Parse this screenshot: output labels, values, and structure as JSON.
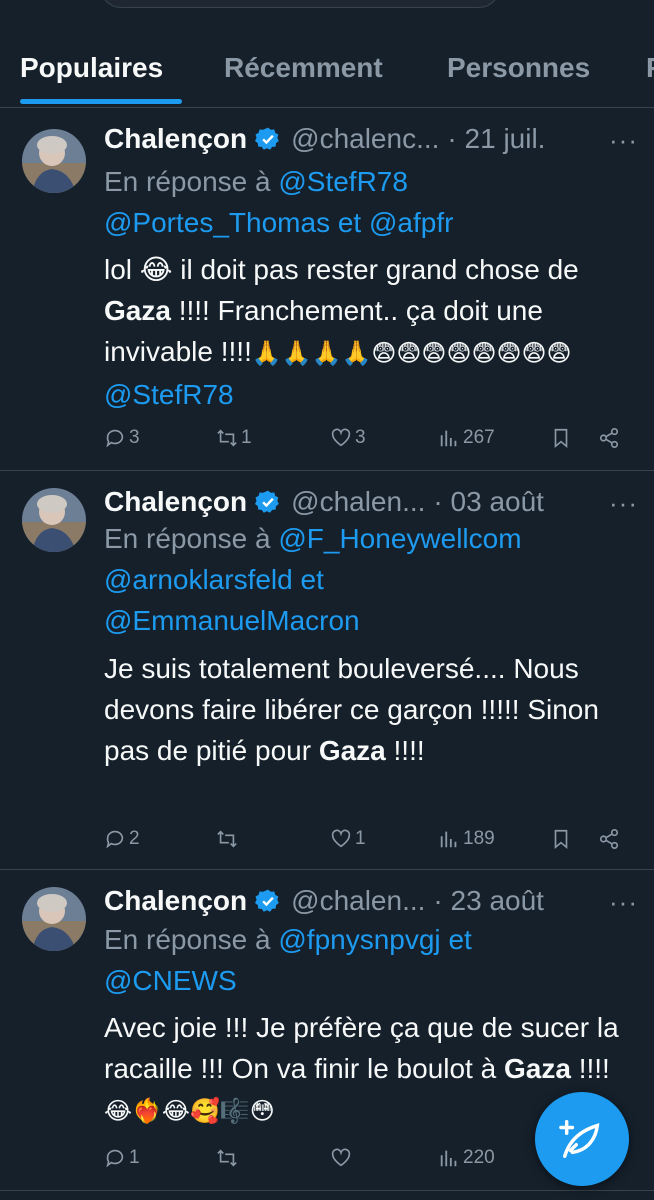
{
  "tabs": [
    {
      "label": "Populaires"
    },
    {
      "label": "Récemment"
    },
    {
      "label": "Personnes"
    },
    {
      "label": "P"
    }
  ],
  "tweets": [
    {
      "name": "Chalençon",
      "handle": "@chalenc...",
      "date": "· 21 juil.",
      "more": "···",
      "reply_prefix": "En réponse à",
      "mentions": [
        "@StefR78",
        "@Portes_Thomas",
        "@afpfr"
      ],
      "conj": "et",
      "text": {
        "t1": "lol 😂 il doit pas rester grand chose de ",
        "bold": "Gaza",
        "t2": " !!!! Franchement.. ça doit une invivable !!!!",
        "emojis": "🙏🙏🙏🙏😨😨😨😨😨😨😨😨",
        "tail_mention": "@StefR78"
      },
      "stats": {
        "replies": "3",
        "retweets": "1",
        "likes": "3",
        "views": "267"
      }
    },
    {
      "name": "Chalençon",
      "handle": "@chalen...",
      "date": "· 03 août",
      "more": "···",
      "reply_prefix": "En réponse à",
      "mentions": [
        "@F_Honeywellcom",
        "@arnoklarsfeld",
        "@EmmanuelMacron"
      ],
      "conj": "et",
      "text": {
        "t1": "Je suis totalement bouleversé.... Nous devons faire libérer ce garçon !!!!!  Sinon pas de pitié pour ",
        "bold": "Gaza",
        "t2": " !!!!"
      },
      "stats": {
        "replies": "2",
        "retweets": "",
        "likes": "1",
        "views": "189"
      }
    },
    {
      "name": "Chalençon",
      "handle": "@chalen...",
      "date": "· 23 août",
      "more": "···",
      "reply_prefix": "En réponse à",
      "mentions": [
        "@fpnysnpvgj",
        "@CNEWS"
      ],
      "conj": "et",
      "text": {
        "t1": "Avec joie !!!  Je préfère ça que de sucer la racaille !!!  On va finir le boulot à ",
        "bold": "Gaza",
        "t2": " !!!!",
        "emojis": "😂❤️‍🔥😂🥰🎼😳"
      },
      "stats": {
        "replies": "1",
        "retweets": "",
        "likes": "",
        "views": "220"
      }
    }
  ],
  "colors": {
    "background": "#15202b",
    "accent": "#1d9bf0",
    "muted": "#8b98a5",
    "border": "#38444d"
  },
  "icons": [
    "reply-icon",
    "retweet-icon",
    "like-icon",
    "views-icon",
    "bookmark-icon",
    "share-icon",
    "verified-icon",
    "compose-icon"
  ]
}
